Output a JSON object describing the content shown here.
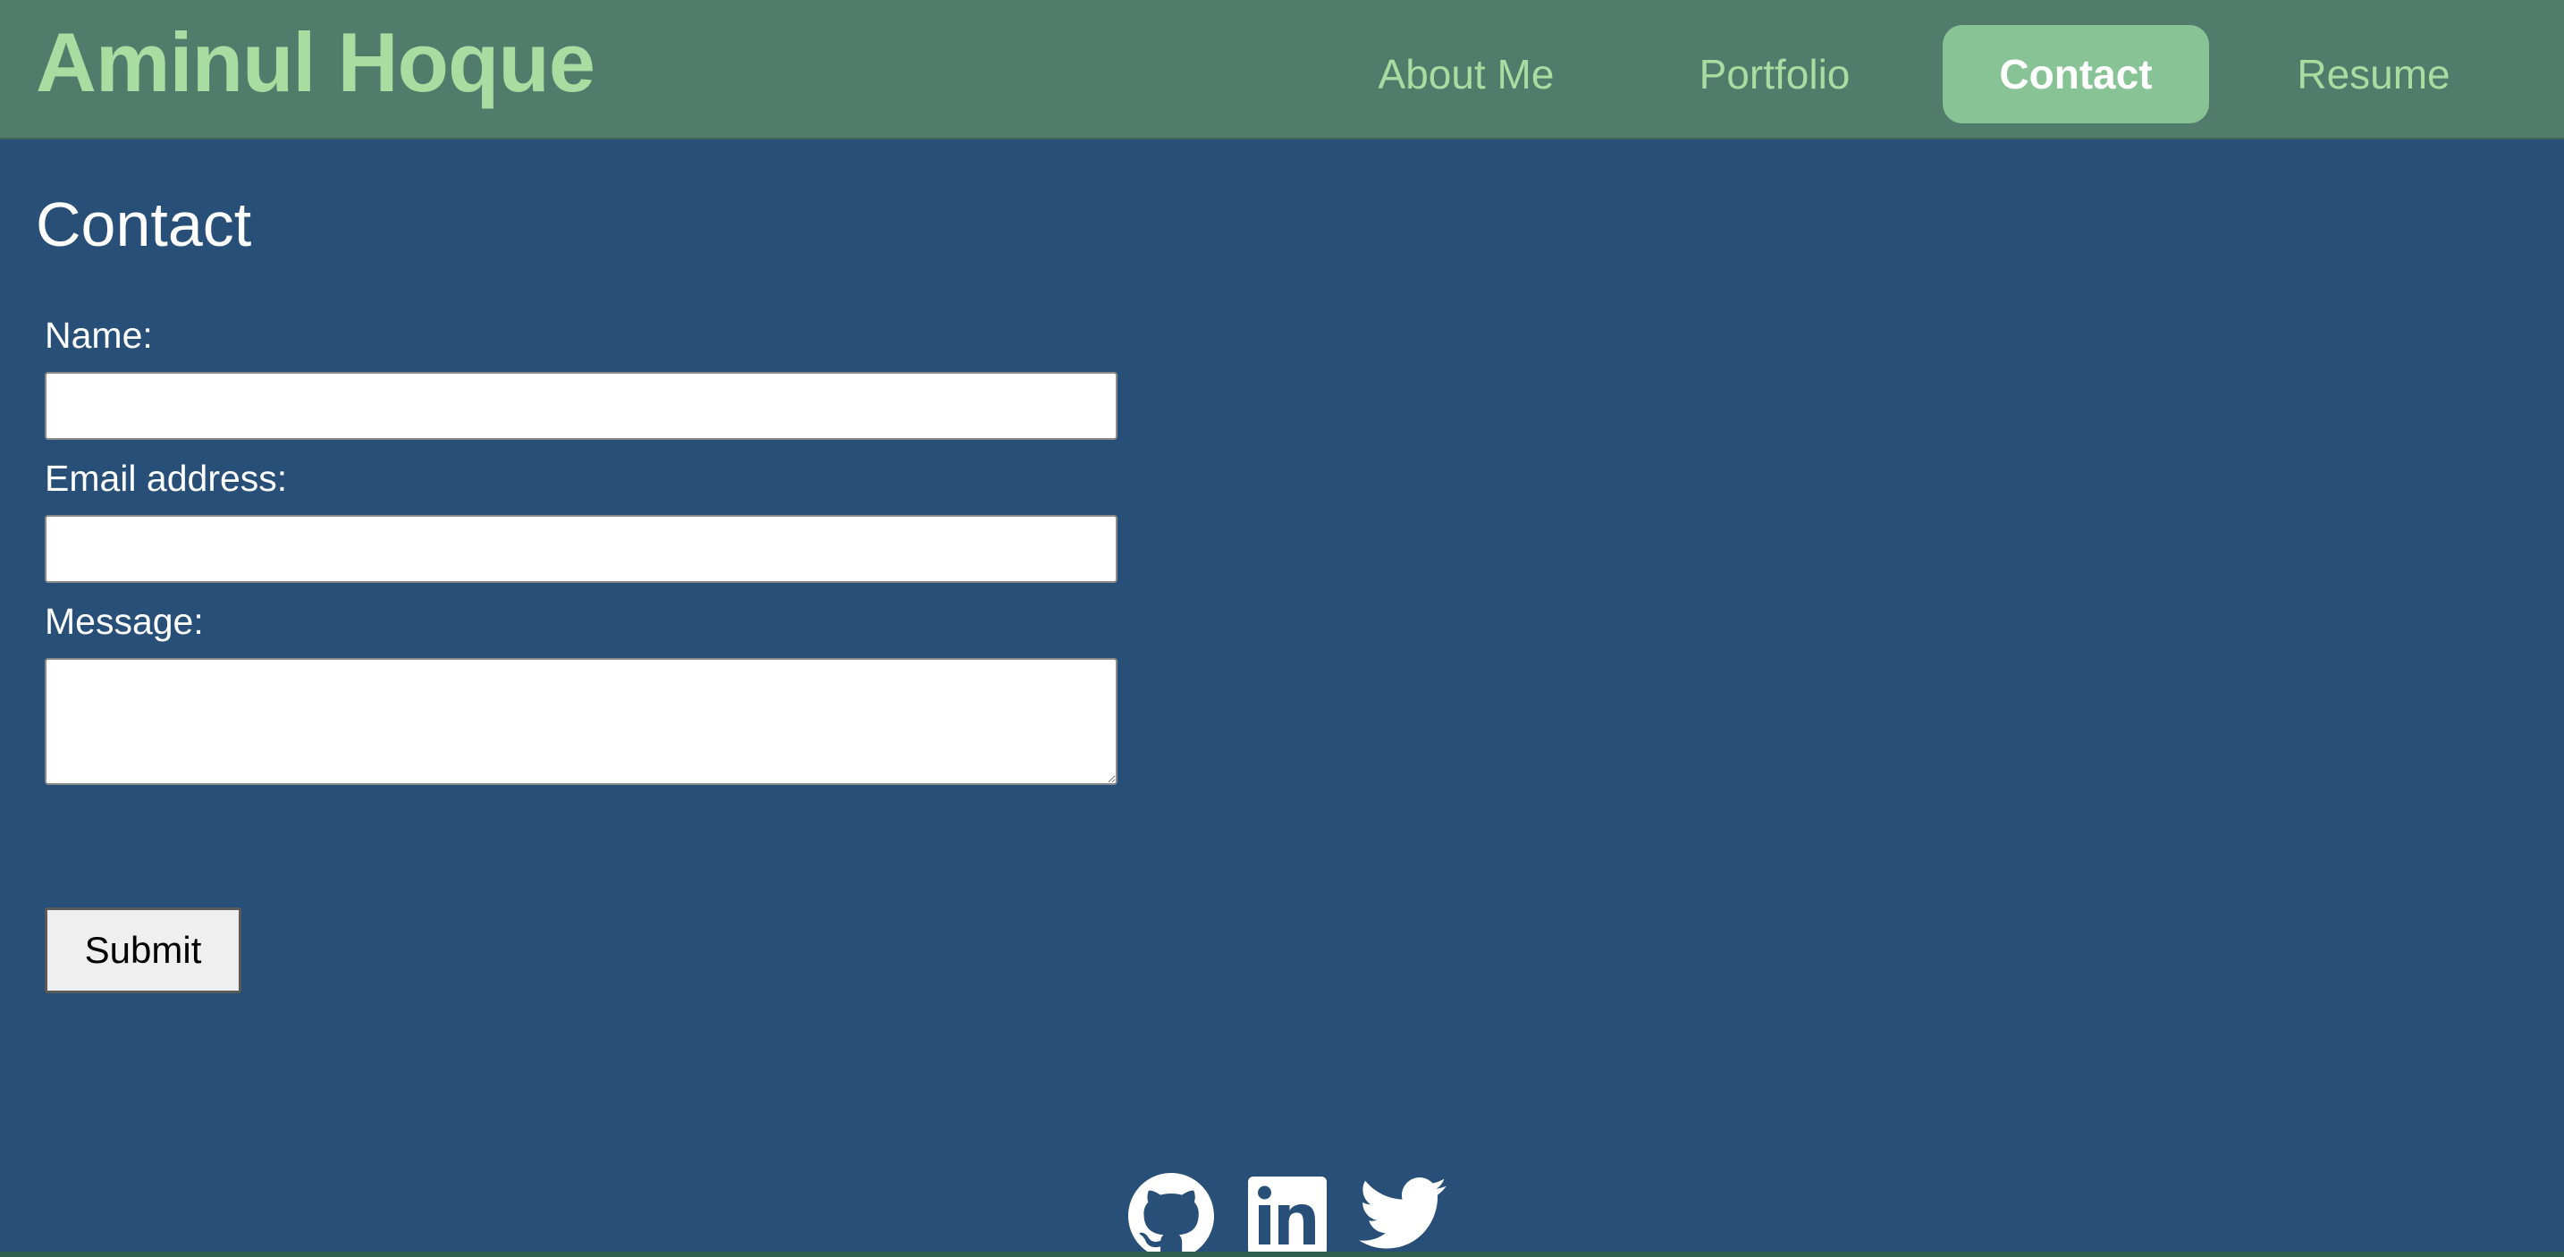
{
  "header": {
    "site_title": "Aminul Hoque",
    "nav": {
      "about": "About Me",
      "portfolio": "Portfolio",
      "contact": "Contact",
      "resume": "Resume"
    },
    "active_nav": "Contact"
  },
  "main": {
    "title": "Contact",
    "form": {
      "name_label": "Name:",
      "name_value": "",
      "email_label": "Email address:",
      "email_value": "",
      "message_label": "Message:",
      "message_value": "",
      "submit_label": "Submit"
    }
  },
  "footer": {
    "social_icons": [
      "github-icon",
      "linkedin-icon",
      "twitter-icon"
    ]
  },
  "colors": {
    "header_bg": "#517c6b",
    "page_bg": "#284f77",
    "title_green": "#a8dca0",
    "active_nav_bg": "#88c395"
  }
}
